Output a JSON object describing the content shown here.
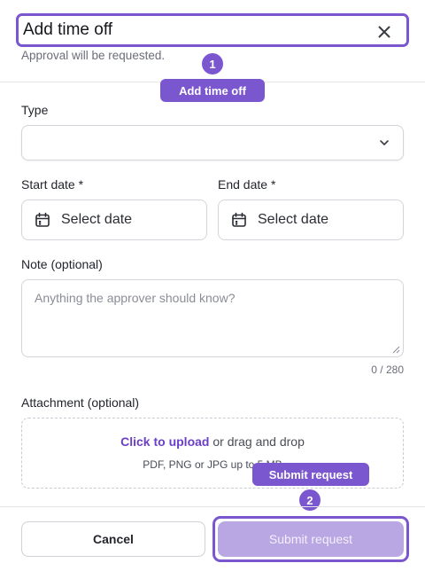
{
  "dialog": {
    "title": "Add time off",
    "subtitle": "Approval will be requested.",
    "close_icon": "close-icon"
  },
  "annotations": {
    "marker_1": "1",
    "tag_1": "Add time off",
    "marker_2": "2",
    "tag_2": "Submit request",
    "color": "#7a56cf"
  },
  "form": {
    "type_label": "Type",
    "type_value": "",
    "start_label": "Start date *",
    "start_placeholder": "Select date",
    "end_label": "End date *",
    "end_placeholder": "Select date",
    "note_label": "Note (optional)",
    "note_placeholder": "Anything the approver should know?",
    "note_counter": "0 / 280",
    "attachment_label": "Attachment (optional)",
    "upload_link": "Click to upload",
    "upload_rest": " or drag and drop",
    "upload_hint": "PDF, PNG or JPG up to 5 MB"
  },
  "footer": {
    "cancel_label": "Cancel",
    "submit_label": "Submit request"
  },
  "colors": {
    "accent": "#7a56cf",
    "submit_disabled": "#b9a7e3",
    "link": "#6b3fc9"
  }
}
